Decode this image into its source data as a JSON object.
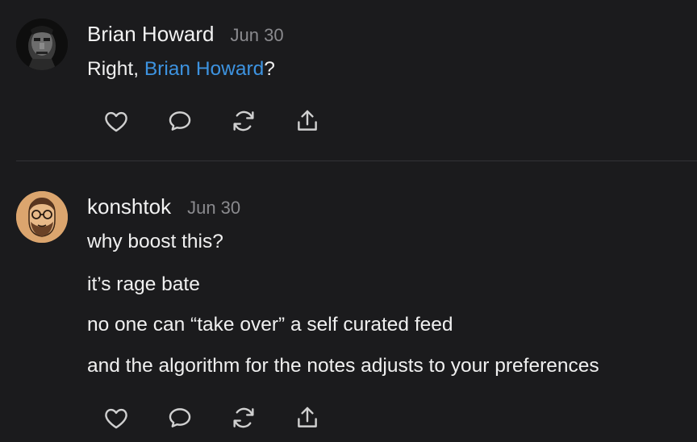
{
  "notes": [
    {
      "author": "Brian Howard",
      "date": "Jun 30",
      "body": {
        "prefix": "Right, ",
        "mention": "Brian Howard",
        "suffix": "?"
      },
      "avatar_icon": "dark-portrait-avatar"
    },
    {
      "author": "konshtok",
      "date": "Jun 30",
      "paragraphs": [
        "why boost this?",
        "it’s rage bate",
        "no one can “take over” a self curated feed",
        "and the algorithm for the notes adjusts to your preferences"
      ],
      "avatar_icon": "bearded-glasses-avatar"
    }
  ],
  "actions": [
    "heart-icon",
    "comment-icon",
    "restack-icon",
    "share-icon"
  ],
  "colors": {
    "background": "#1b1b1d",
    "text": "#f0f0f0",
    "muted": "#8a8a8e",
    "mention": "#3d93e0",
    "divider": "#333336"
  }
}
